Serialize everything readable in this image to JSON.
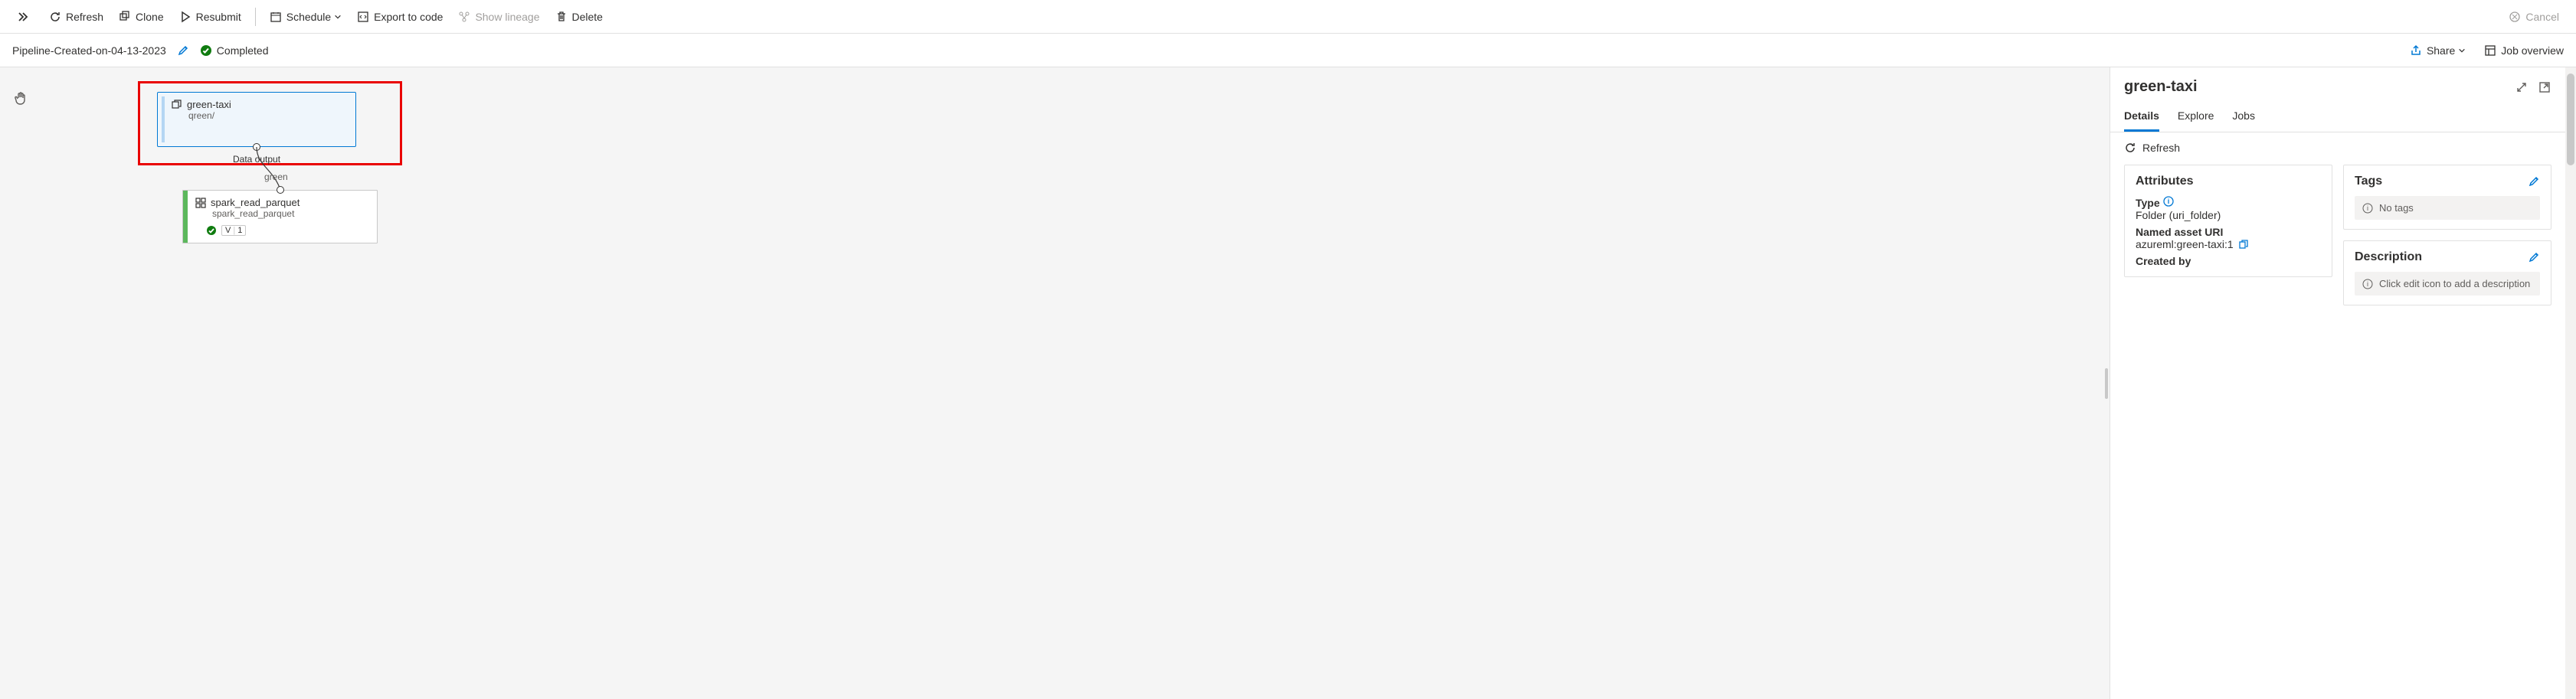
{
  "toolbar": {
    "refresh": "Refresh",
    "clone": "Clone",
    "resubmit": "Resubmit",
    "schedule": "Schedule",
    "export": "Export to code",
    "lineage": "Show lineage",
    "delete": "Delete",
    "cancel": "Cancel"
  },
  "titlebar": {
    "pipeline_name": "Pipeline-Created-on-04-13-2023",
    "status": "Completed",
    "share": "Share",
    "job_overview": "Job overview"
  },
  "graph": {
    "node1": {
      "title": "green-taxi",
      "sub": "qreen/",
      "out_port_label": "Data output"
    },
    "edge_label": "green",
    "node2": {
      "title": "spark_read_parquet",
      "sub": "spark_read_parquet",
      "version_letter": "V",
      "version_number": "1"
    }
  },
  "panel": {
    "title": "green-taxi",
    "tabs": {
      "details": "Details",
      "explore": "Explore",
      "jobs": "Jobs"
    },
    "refresh": "Refresh",
    "attributes": {
      "heading": "Attributes",
      "type_label": "Type",
      "type_value": "Folder (uri_folder)",
      "uri_label": "Named asset URI",
      "uri_value": "azureml:green-taxi:1",
      "createdby_label": "Created by"
    },
    "tags": {
      "heading": "Tags",
      "placeholder": "No tags"
    },
    "description": {
      "heading": "Description",
      "placeholder": "Click edit icon to add a description"
    }
  }
}
